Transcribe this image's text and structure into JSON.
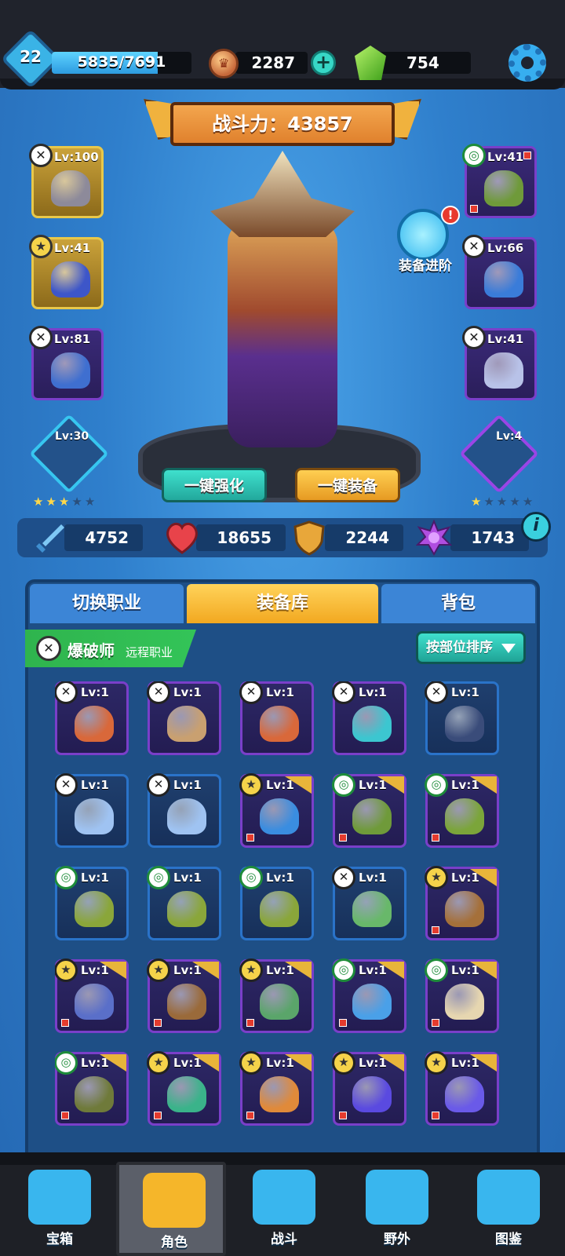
{
  "player": {
    "level": "22",
    "xp_text": "5835/7691",
    "xp_fraction": 0.759
  },
  "currency": {
    "coins": "2287",
    "gems": "754",
    "coin_symbol": "♛",
    "plus": "+"
  },
  "power": {
    "label": "战斗力：43857"
  },
  "left_slots": [
    {
      "lv": "Lv:100",
      "badge": "✕",
      "style": "gold",
      "color": "#8d8a9a"
    },
    {
      "lv": "Lv:41",
      "badge": "★",
      "style": "gold",
      "color": "#3d56c9"
    },
    {
      "lv": "Lv:81",
      "badge": "✕",
      "style": "purple",
      "color": "#3f6fd0"
    }
  ],
  "right_slots": [
    {
      "lv": "Lv:41",
      "badge": "◎",
      "style": "purple",
      "color": "#6f9a3a"
    },
    {
      "lv": "Lv:66",
      "badge": "✕",
      "style": "purple",
      "color": "#3a7cd9"
    },
    {
      "lv": "Lv:41",
      "badge": "✕",
      "style": "purple",
      "color": "#b8c2e8"
    }
  ],
  "pets": {
    "left": {
      "lv": "Lv:30",
      "stars": "★★★★★",
      "filled": 3
    },
    "right": {
      "lv": "Lv:4",
      "stars": "★★★★★",
      "filled": 1
    }
  },
  "advance": {
    "label": "装备进阶",
    "alert": "!"
  },
  "actions": {
    "enhance": "一键强化",
    "equip": "一键装备"
  },
  "stats": {
    "attack": "4752",
    "hp": "18655",
    "defense": "2244",
    "magic": "1743",
    "info": "i"
  },
  "tabs": {
    "switch_class": "切换职业",
    "armory": "装备库",
    "backpack": "背包",
    "active": "armory"
  },
  "class": {
    "icon": "✕",
    "name": "爆破师",
    "type": "远程职业"
  },
  "sort": {
    "label": "按部位排序"
  },
  "items": [
    {
      "lv": "Lv:1",
      "badge": "✕",
      "frame": "purple",
      "color": "#d9683a"
    },
    {
      "lv": "Lv:1",
      "badge": "✕",
      "frame": "purple",
      "color": "#c9a070"
    },
    {
      "lv": "Lv:1",
      "badge": "✕",
      "frame": "purple",
      "color": "#d9683a"
    },
    {
      "lv": "Lv:1",
      "badge": "✕",
      "frame": "purple",
      "color": "#3cc6d0"
    },
    {
      "lv": "Lv:1",
      "badge": "✕",
      "frame": "blue",
      "color": "#3a4c7a"
    },
    {
      "lv": "Lv:1",
      "badge": "✕",
      "frame": "blue",
      "color": "#9fc3f2"
    },
    {
      "lv": "Lv:1",
      "badge": "✕",
      "frame": "blue",
      "color": "#9fc3f2"
    },
    {
      "lv": "Lv:1",
      "badge": "★",
      "frame": "purple",
      "color": "#3a8de0"
    },
    {
      "lv": "Lv:1",
      "badge": "◎",
      "frame": "purple",
      "color": "#6f9a3a"
    },
    {
      "lv": "Lv:1",
      "badge": "◎",
      "frame": "purple",
      "color": "#7ba53a"
    },
    {
      "lv": "Lv:1",
      "badge": "◎",
      "frame": "blue",
      "color": "#8aa63a"
    },
    {
      "lv": "Lv:1",
      "badge": "◎",
      "frame": "blue",
      "color": "#8aa63a"
    },
    {
      "lv": "Lv:1",
      "badge": "◎",
      "frame": "blue",
      "color": "#8aa63a"
    },
    {
      "lv": "Lv:1",
      "badge": "✕",
      "frame": "blue",
      "color": "#68b86a"
    },
    {
      "lv": "Lv:1",
      "badge": "★",
      "frame": "purple",
      "color": "#a5703a"
    },
    {
      "lv": "Lv:1",
      "badge": "★",
      "frame": "purple",
      "color": "#5a6fc9"
    },
    {
      "lv": "Lv:1",
      "badge": "★",
      "frame": "purple",
      "color": "#9a6a3a"
    },
    {
      "lv": "Lv:1",
      "badge": "★",
      "frame": "purple",
      "color": "#5aa56a"
    },
    {
      "lv": "Lv:1",
      "badge": "◎",
      "frame": "purple",
      "color": "#4aa0e8"
    },
    {
      "lv": "Lv:1",
      "badge": "◎",
      "frame": "purple",
      "color": "#e6d6b0"
    },
    {
      "lv": "Lv:1",
      "badge": "◎",
      "frame": "purple",
      "color": "#6f7a3a"
    },
    {
      "lv": "Lv:1",
      "badge": "★",
      "frame": "purple",
      "color": "#3ab38a"
    },
    {
      "lv": "Lv:1",
      "badge": "★",
      "frame": "purple",
      "color": "#e08a3a"
    },
    {
      "lv": "Lv:1",
      "badge": "★",
      "frame": "purple",
      "color": "#5a4ae0"
    },
    {
      "lv": "Lv:1",
      "badge": "★",
      "frame": "purple",
      "color": "#6a5ae8"
    }
  ],
  "nav": [
    {
      "label": "宝箱",
      "icon": "chest-icon"
    },
    {
      "label": "角色",
      "icon": "helmet-icon",
      "active": true
    },
    {
      "label": "战斗",
      "icon": "crossed-swords-icon"
    },
    {
      "label": "野外",
      "icon": "castle-icon"
    },
    {
      "label": "图鉴",
      "icon": "book-icon"
    }
  ]
}
